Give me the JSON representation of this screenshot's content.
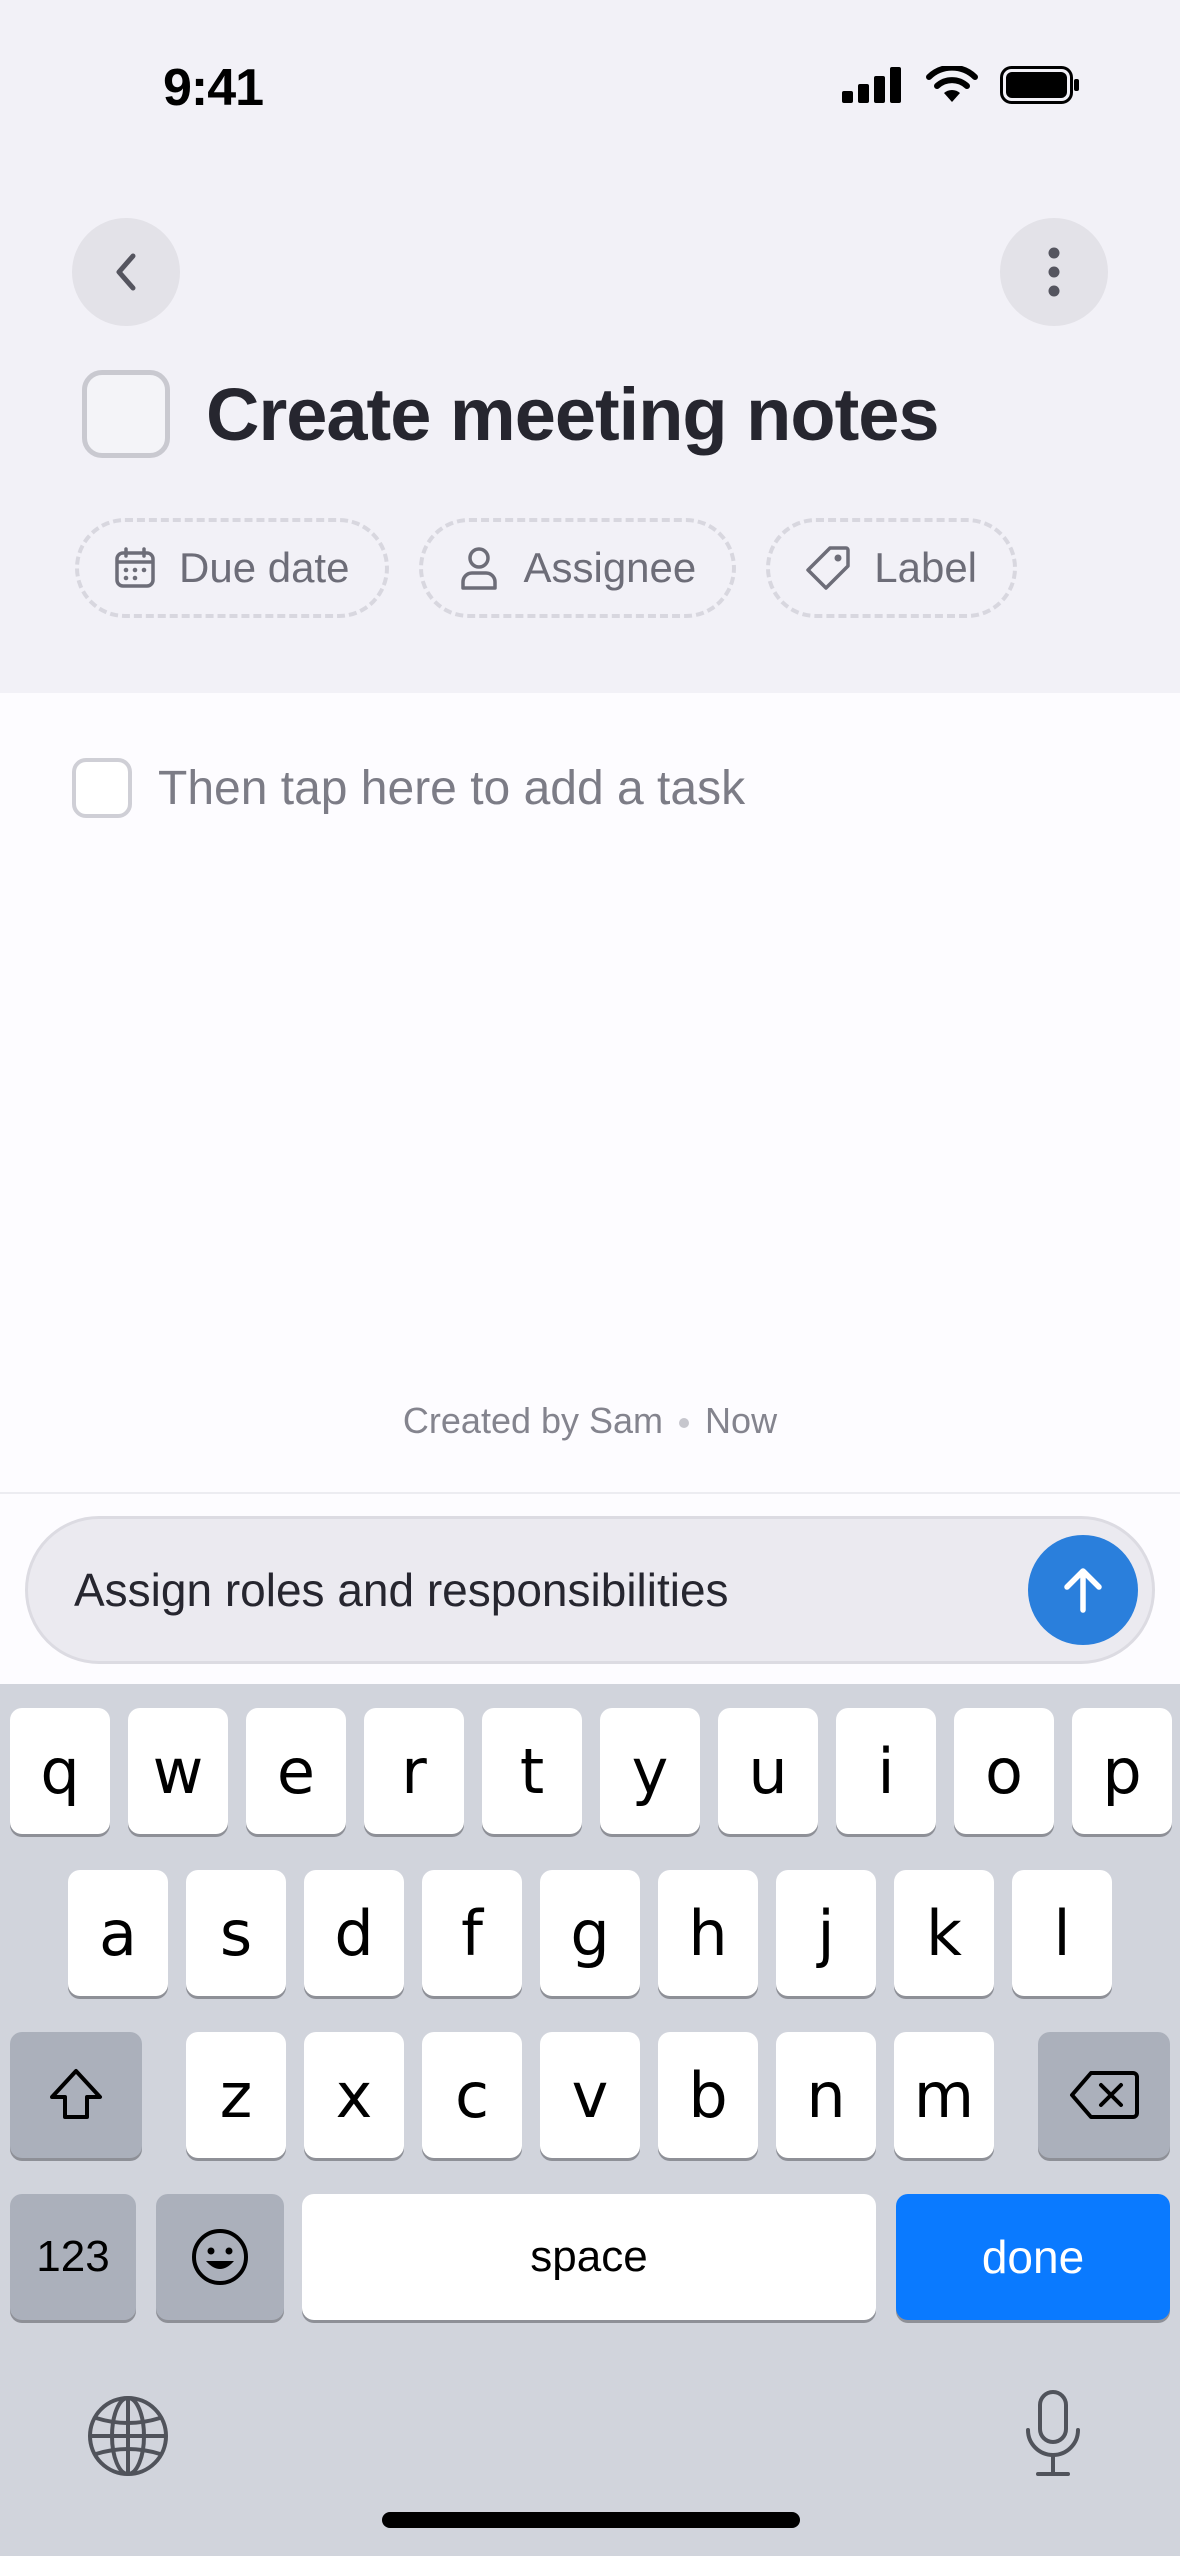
{
  "status_bar": {
    "time": "9:41"
  },
  "header": {
    "title": "Create meeting notes",
    "chips": [
      {
        "label": "Due date",
        "icon": "calendar-icon"
      },
      {
        "label": "Assignee",
        "icon": "person-icon"
      },
      {
        "label": "Label",
        "icon": "tag-icon"
      }
    ]
  },
  "subtask": {
    "placeholder": "Then tap here to add a task"
  },
  "footer": {
    "created_by": "Created by Sam",
    "created_when": "Now"
  },
  "composer": {
    "value": "Assign roles and responsibilities"
  },
  "keyboard": {
    "row1": [
      "q",
      "w",
      "e",
      "r",
      "t",
      "y",
      "u",
      "i",
      "o",
      "p"
    ],
    "row2": [
      "a",
      "s",
      "d",
      "f",
      "g",
      "h",
      "j",
      "k",
      "l"
    ],
    "row3": [
      "z",
      "x",
      "c",
      "v",
      "b",
      "n",
      "m"
    ],
    "numbers_label": "123",
    "space_label": "space",
    "done_label": "done"
  },
  "colors": {
    "accent": "#2a7fdc",
    "done_key": "#0a7aff"
  }
}
